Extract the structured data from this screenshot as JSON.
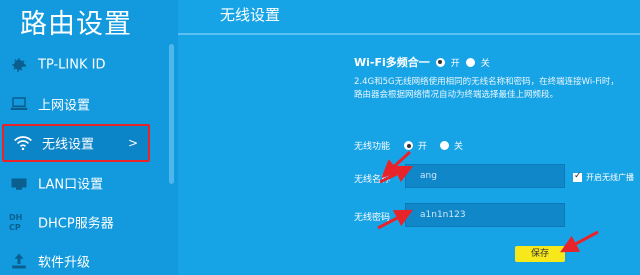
{
  "sidebar": {
    "title": "路由设置",
    "items": [
      {
        "label": "TP-LINK ID",
        "icon": "gear-icon"
      },
      {
        "label": "上网设置",
        "icon": "laptop-icon"
      },
      {
        "label": "无线设置",
        "icon": "wifi-icon",
        "active": true,
        "chevron": ">"
      },
      {
        "label": "LAN口设置",
        "icon": "lan-port-icon"
      },
      {
        "label": "DHCP服务器",
        "icon": "dhcp-icon",
        "icon_text": "DH CP"
      },
      {
        "label": "软件升级",
        "icon": "upgrade-icon"
      }
    ]
  },
  "main": {
    "title": "无线设置",
    "wifi_combine": {
      "label": "Wi-Fi多频合一",
      "on_label": "开",
      "off_label": "关",
      "selected": "on"
    },
    "description": "2.4G和5G无线网络使用相同的无线名称和密码，在终端连接Wi-Fi时，路由器会根据网络情况自动为终端选择最佳上网频段。",
    "wireless_function": {
      "label": "无线功能",
      "on_label": "开",
      "off_label": "关",
      "selected": "on"
    },
    "ssid": {
      "label": "无线名称",
      "value": "ang"
    },
    "broadcast": {
      "label": "开启无线广播",
      "checked": true
    },
    "password": {
      "label": "无线密码",
      "value": "a1n1n123"
    },
    "save_label": "保存"
  },
  "colors": {
    "background": "#17a4e6",
    "sidebar": "#1299de",
    "active_border": "#e8232a",
    "save_button": "#f7e81c",
    "annotation_arrow": "#e8232a"
  }
}
